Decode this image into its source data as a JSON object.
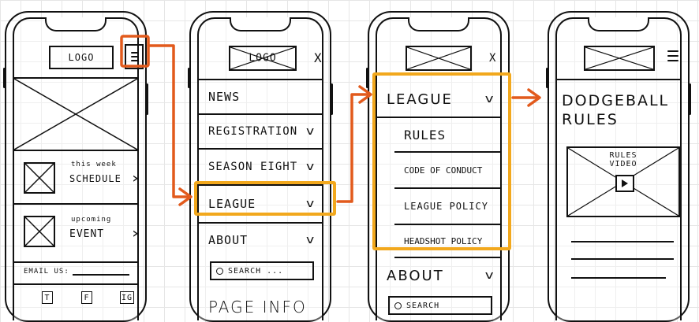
{
  "colors": {
    "arrow": "#e25a1c",
    "highlight": "#f2a81d",
    "ink": "#111111",
    "grid": "#e6e6e6"
  },
  "screen1": {
    "logo": "LOGO",
    "schedule": {
      "caption": "this week",
      "label": "SCHEDULE"
    },
    "event": {
      "caption": "upcoming",
      "label": "EVENT"
    },
    "email_label": "EMAIL US:",
    "social": [
      "T",
      "F",
      "IG"
    ]
  },
  "screen2": {
    "logo": "LOGO",
    "close": "X",
    "menu": [
      {
        "label": "NEWS",
        "chevron": false
      },
      {
        "label": "REGISTRATION",
        "chevron": true
      },
      {
        "label": "SEASON EIGHT",
        "chevron": true
      },
      {
        "label": "LEAGUE",
        "chevron": true
      },
      {
        "label": "ABOUT",
        "chevron": true
      }
    ],
    "search_placeholder": "SEARCH ...",
    "footer": "PAGE INFO"
  },
  "screen3": {
    "close": "X",
    "league": "LEAGUE",
    "submenu": [
      "RULES",
      "CODE OF CONDUCT",
      "LEAGUE POLICY",
      "HEADSHOT POLICY"
    ],
    "about": "ABOUT",
    "search_placeholder": "SEARCH"
  },
  "screen4": {
    "title_line1": "DODGEBALL",
    "title_line2": "RULES",
    "video_label_1": "RULES",
    "video_label_2": "VIDEO"
  }
}
